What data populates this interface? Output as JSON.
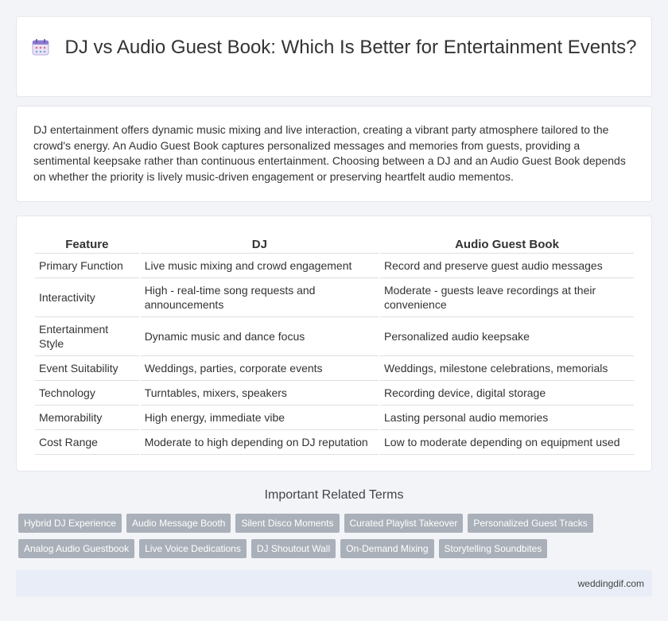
{
  "header": {
    "icon": "calendar-icon",
    "title": "DJ vs Audio Guest Book: Which Is Better for Entertainment Events?"
  },
  "intro": {
    "text": "DJ entertainment offers dynamic music mixing and live interaction, creating a vibrant party atmosphere tailored to the crowd's energy. An Audio Guest Book captures personalized messages and memories from guests, providing a sentimental keepsake rather than continuous entertainment. Choosing between a DJ and an Audio Guest Book depends on whether the priority is lively music-driven engagement or preserving heartfelt audio mementos."
  },
  "table": {
    "headers": [
      "Feature",
      "DJ",
      "Audio Guest Book"
    ],
    "rows": [
      [
        "Primary Function",
        "Live music mixing and crowd engagement",
        "Record and preserve guest audio messages"
      ],
      [
        "Interactivity",
        "High - real-time song requests and announcements",
        "Moderate - guests leave recordings at their convenience"
      ],
      [
        "Entertainment Style",
        "Dynamic music and dance focus",
        "Personalized audio keepsake"
      ],
      [
        "Event Suitability",
        "Weddings, parties, corporate events",
        "Weddings, milestone celebrations, memorials"
      ],
      [
        "Technology",
        "Turntables, mixers, speakers",
        "Recording device, digital storage"
      ],
      [
        "Memorability",
        "High energy, immediate vibe",
        "Lasting personal audio memories"
      ],
      [
        "Cost Range",
        "Moderate to high depending on DJ reputation",
        "Low to moderate depending on equipment used"
      ]
    ]
  },
  "related": {
    "heading": "Important Related Terms",
    "tags_row1": [
      "Hybrid DJ Experience",
      "Audio Message Booth",
      "Silent Disco Moments",
      "Curated Playlist Takeover",
      "Personalized Guest Tracks"
    ],
    "tags_row2": [
      "Analog Audio Guestbook",
      "Live Voice Dedications",
      "DJ Shoutout Wall",
      "On-Demand Mixing",
      "Storytelling Soundbites"
    ]
  },
  "footer": {
    "site": "weddingdif.com"
  },
  "colors": {
    "background": "#f2f4f8",
    "tag": "#aab0b9",
    "footer": "#e8edf7"
  }
}
